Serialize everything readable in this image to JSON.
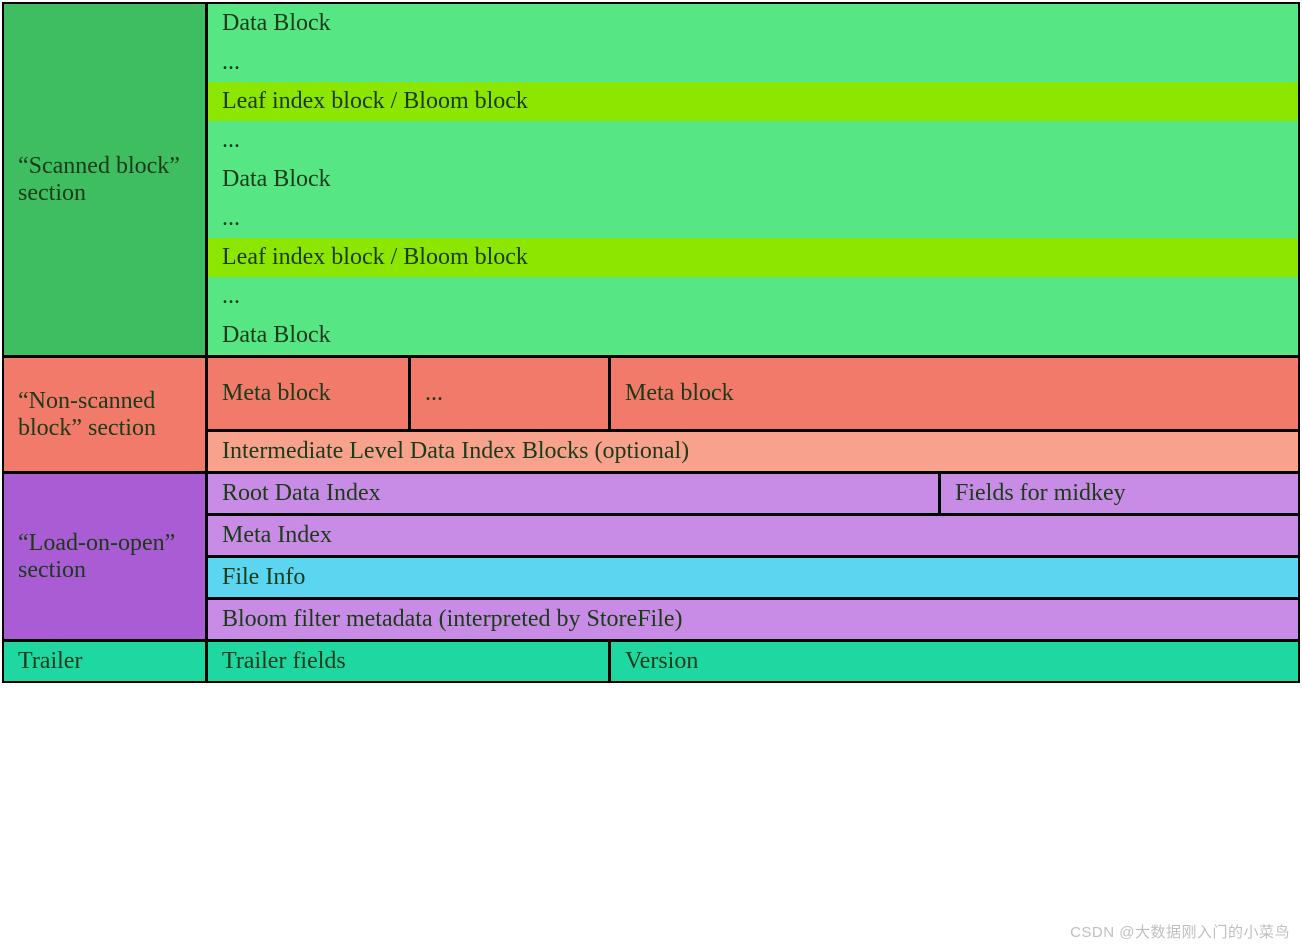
{
  "scanned": {
    "label": "“Scanned block” section",
    "rows": [
      {
        "text": "Data Block",
        "color": "green-light"
      },
      {
        "text": "...",
        "color": "green-light"
      },
      {
        "text": "Leaf index block / Bloom block",
        "color": "lime"
      },
      {
        "text": "...",
        "color": "green-light"
      },
      {
        "text": "Data Block",
        "color": "green-light"
      },
      {
        "text": "...",
        "color": "green-light"
      },
      {
        "text": "Leaf index block / Bloom block",
        "color": "lime"
      },
      {
        "text": "...",
        "color": "green-light"
      },
      {
        "text": "Data Block",
        "color": "green-light"
      }
    ]
  },
  "nonscanned": {
    "label": "“Non-scanned block” section",
    "meta1": "Meta block",
    "meta_ellipsis": "...",
    "meta2": "Meta block",
    "intermediate": "Intermediate Level Data Index Blocks (optional)"
  },
  "loadonopen": {
    "label": "“Load-on-open” section",
    "root_index": "Root Data Index",
    "fields_midkey": "Fields for midkey",
    "meta_index": "Meta Index",
    "file_info": "File Info",
    "bloom_meta": "Bloom filter metadata (interpreted by StoreFile)"
  },
  "trailer": {
    "label": "Trailer",
    "fields": "Trailer fields",
    "version": "Version"
  },
  "watermark": "CSDN @大数据刚入门的小菜鸟"
}
